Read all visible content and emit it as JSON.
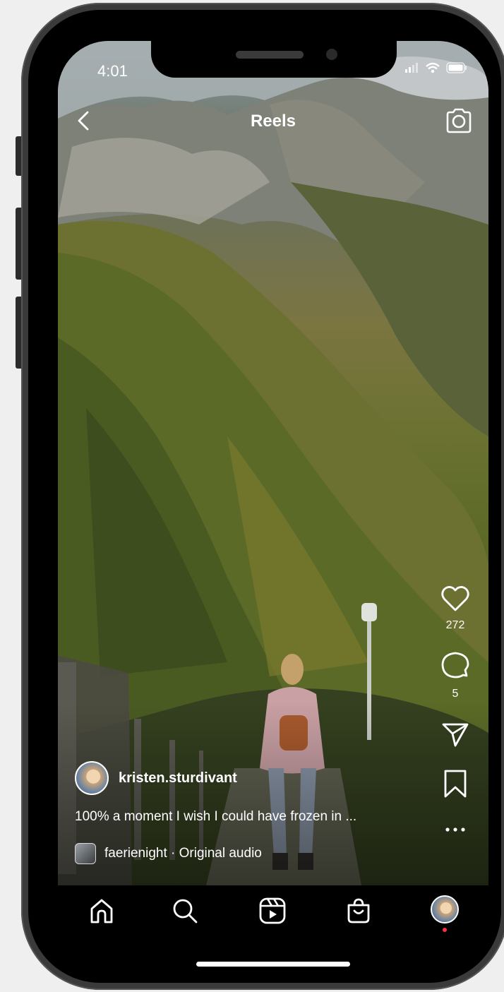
{
  "status_bar": {
    "time": "4:01"
  },
  "header": {
    "title": "Reels"
  },
  "actions": {
    "likes": "272",
    "comments": "5"
  },
  "post": {
    "username": "kristen.sturdivant",
    "caption": "100% a moment I wish I could have frozen in ...",
    "audio": "faerienight · Original audio"
  },
  "icons": {
    "back": "chevron-left-icon",
    "camera": "camera-icon",
    "like": "heart-icon",
    "comment": "comment-bubble-icon",
    "share": "paper-plane-icon",
    "save": "bookmark-icon",
    "more": "ellipsis-icon",
    "nav": [
      "home-icon",
      "search-icon",
      "reels-icon",
      "shop-icon",
      "profile-avatar"
    ]
  },
  "colors": {
    "notification_dot": "#ff2f40",
    "text": "#ffffff",
    "nav_background": "#000000"
  }
}
